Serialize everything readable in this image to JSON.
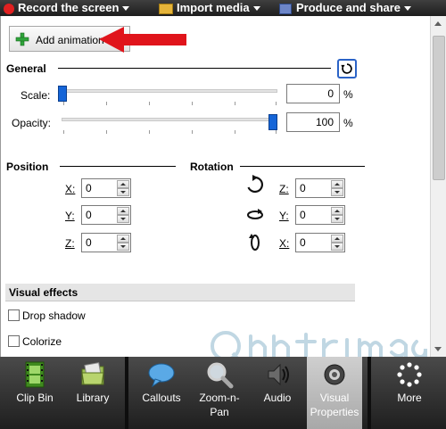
{
  "top_menu": {
    "record_label": "Record the screen",
    "import_label": "Import media",
    "produce_label": "Produce and share"
  },
  "add_animation": {
    "label": "Add animation"
  },
  "general": {
    "heading": "General",
    "scale_label": "Scale:",
    "scale_value": "0",
    "opacity_label": "Opacity:",
    "opacity_value": "100",
    "percent": "%",
    "scale_level": 0,
    "opacity_level": 1.0
  },
  "position": {
    "heading": "Position",
    "x_label": "X:",
    "x_value": "0",
    "y_label": "Y:",
    "y_value": "0",
    "z_label": "Z:",
    "z_value": "0"
  },
  "rotation": {
    "heading": "Rotation",
    "z_label": "Z:",
    "z_value": "0",
    "y_label": "Y:",
    "y_value": "0",
    "x_label": "X:",
    "x_value": "0"
  },
  "visual_effects": {
    "heading": "Visual effects",
    "drop_shadow_label": "Drop shadow",
    "colorize_label": "Colorize"
  },
  "toolbar": {
    "clip_bin": "Clip Bin",
    "library": "Library",
    "callouts": "Callouts",
    "zoom_n_pan_line1": "Zoom-n-",
    "zoom_n_pan_line2": "Pan",
    "audio": "Audio",
    "visual_properties_line1": "Visual",
    "visual_properties_line2": "Properties",
    "more": "More"
  },
  "colors": {
    "accent_blue": "#1565d8",
    "arrow_red": "#e0141b",
    "toolbar_dark": "#2a2a2a"
  }
}
